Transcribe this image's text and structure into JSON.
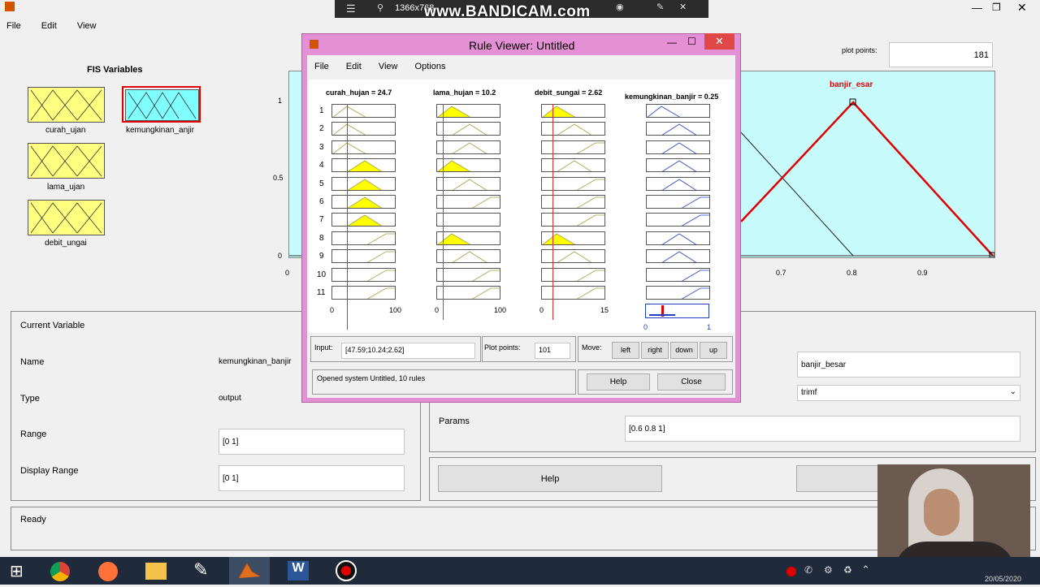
{
  "bandicam": {
    "resolution": "1366x768",
    "brand": "www.BANDICAM.com"
  },
  "main_menu": [
    "File",
    "Edit",
    "View"
  ],
  "fis": {
    "heading": "FIS Variables",
    "inputs": [
      {
        "label": "curah_ujan"
      },
      {
        "label": "lama_ujan"
      },
      {
        "label": "debit_ungai"
      }
    ],
    "output": {
      "label": "kemungkinan_anjir"
    },
    "plot_points_label": "plot points:",
    "plot_points_value": "181",
    "mf_title": "banjir_esar",
    "y_ticks": [
      "1",
      "0.5",
      "0"
    ],
    "x_ticks": [
      "0",
      "0.7",
      "0.8",
      "0.9"
    ]
  },
  "var_panel": {
    "current_variable": "Current Variable",
    "name_label": "Name",
    "name_value": "kemungkinan_banjir",
    "type_label": "Type",
    "type_value": "output",
    "range_label": "Range",
    "range_value": "[0 1]",
    "display_range_label": "Display Range",
    "display_range_value": "[0 1]",
    "mf_name": "banjir_besar",
    "mf_type": "trimf",
    "params_label": "Params",
    "params_value": "[0.6 0.8 1]",
    "help": "Help",
    "status": "Ready"
  },
  "rule_viewer": {
    "title": "Rule Viewer: Untitled",
    "menu": [
      "File",
      "Edit",
      "View",
      "Options"
    ],
    "var_headers": [
      "curah_hujan = 24.7",
      "lama_hujan = 10.2",
      "debit_sungai = 2.62",
      "kemungkinan_banjir = 0.25"
    ],
    "rows": [
      "1",
      "2",
      "3",
      "4",
      "5",
      "6",
      "7",
      "8",
      "9",
      "10",
      "11"
    ],
    "axis": {
      "c1": [
        "0",
        "100"
      ],
      "c2": [
        "0",
        "100"
      ],
      "c3": [
        "0",
        "15"
      ],
      "c4": [
        "0",
        "1"
      ]
    },
    "input_label": "Input:",
    "input_value": "[47.59;10.24;2.62]",
    "plot_points_label": "Plot points:",
    "plot_points_value": "101",
    "move_label": "Move:",
    "move_buttons": [
      "left",
      "right",
      "down",
      "up"
    ],
    "status": "Opened system Untitled, 10 rules",
    "help": "Help",
    "close": "Close"
  },
  "taskbar": {
    "date": "20/05/2020"
  }
}
